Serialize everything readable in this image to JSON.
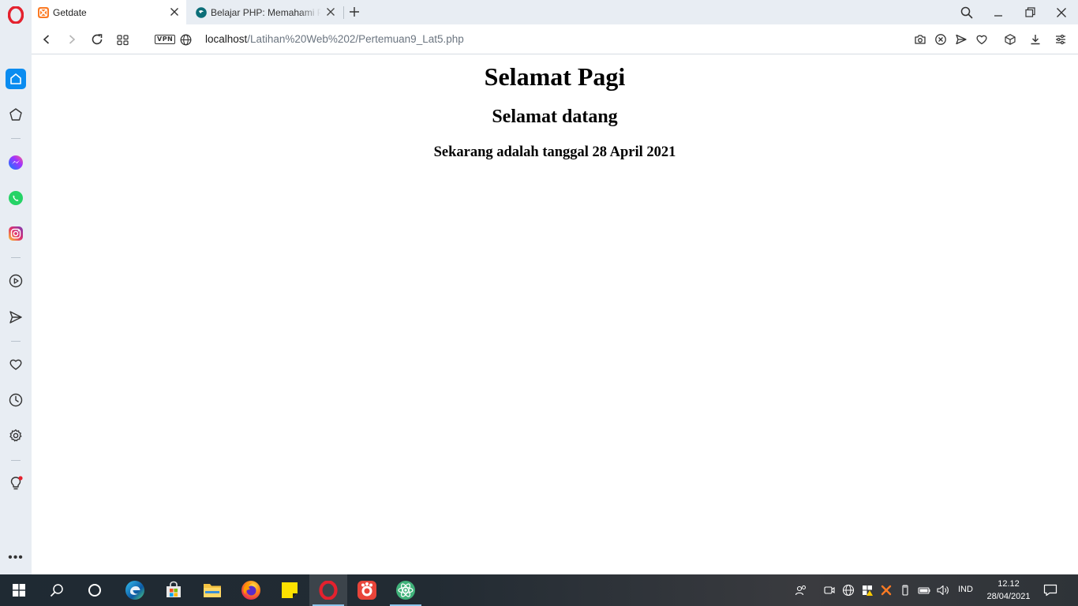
{
  "browser": {
    "tabs": [
      {
        "title": "Getdate",
        "active": true,
        "favicon": "xampp-icon"
      },
      {
        "title": "Belajar PHP: Memahami Pr",
        "active": false,
        "favicon": "site-icon"
      }
    ],
    "url": {
      "host": "localhost",
      "path": "/Latihan%20Web%202/Pertemuan9_Lat5.php"
    },
    "vpn_label": "VPN"
  },
  "page": {
    "heading1": "Selamat Pagi",
    "heading2": "Selamat datang",
    "heading3": "Sekarang adalah tanggal 28 April 2021"
  },
  "sidebar": {
    "items": [
      "home-icon",
      "speed-dial-icon",
      "messenger-icon",
      "whatsapp-icon",
      "instagram-icon",
      "player-icon",
      "flow-icon",
      "bookmarks-icon",
      "history-icon",
      "settings-icon",
      "tips-icon"
    ],
    "more_label": "•••"
  },
  "taskbar": {
    "apps": [
      "start",
      "search",
      "cortana",
      "edge",
      "store",
      "file-explorer",
      "firefox",
      "sticky-notes",
      "opera",
      "app-red",
      "atom"
    ],
    "language": "IND",
    "time": "12.12",
    "date": "28/04/2021"
  },
  "colors": {
    "sidebar_bg": "#e8edf3",
    "accent_blue": "#0a8cf0",
    "opera_red": "#e4212e"
  }
}
